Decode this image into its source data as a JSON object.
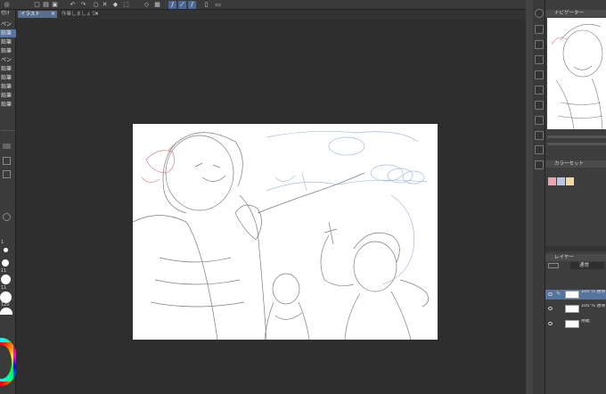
{
  "toolbar": {
    "icons": [
      "app-icon",
      "new-file-icon",
      "open-file-icon",
      "save-icon",
      "undo-icon",
      "redo-icon",
      "shape-icon",
      "clear-icon",
      "fill-icon",
      "transform-icon",
      "ruler-icon",
      "pen-line-icon",
      "pen-curve-icon",
      "pen-smooth-icon",
      "phone-icon",
      "tablet-icon"
    ]
  },
  "tabs": [
    {
      "label": "イラスト"
    },
    {
      "label": "作業しましょう"
    }
  ],
  "tool_panel": {
    "title": "付け",
    "items": [
      "ペン",
      "鉛筆",
      "鉛筆",
      "鉛筆",
      "ペン",
      "鉛筆",
      "鉛筆",
      "鉛筆",
      "鉛筆",
      "鉛筆"
    ],
    "sizes": [
      "1",
      "11",
      "11",
      "120"
    ]
  },
  "navigator": {
    "title": "ナビゲーター"
  },
  "color_palette": {
    "title": "カラーセット",
    "swatches": [
      "#e8a5b0",
      "#b9c6e4",
      "#f2d7a8"
    ]
  },
  "layers_panel": {
    "title": "レイヤー",
    "blend_mode": "通常",
    "layers": [
      {
        "name": "100 % 通常 ラフ",
        "selected": true
      },
      {
        "name": "100 % 通常 レイヤー",
        "selected": false
      },
      {
        "name": "用紙",
        "selected": false
      }
    ]
  },
  "colors": {
    "accent": "#55749e",
    "canvas": "#ffffff",
    "workspace": "#2e2e2e"
  }
}
